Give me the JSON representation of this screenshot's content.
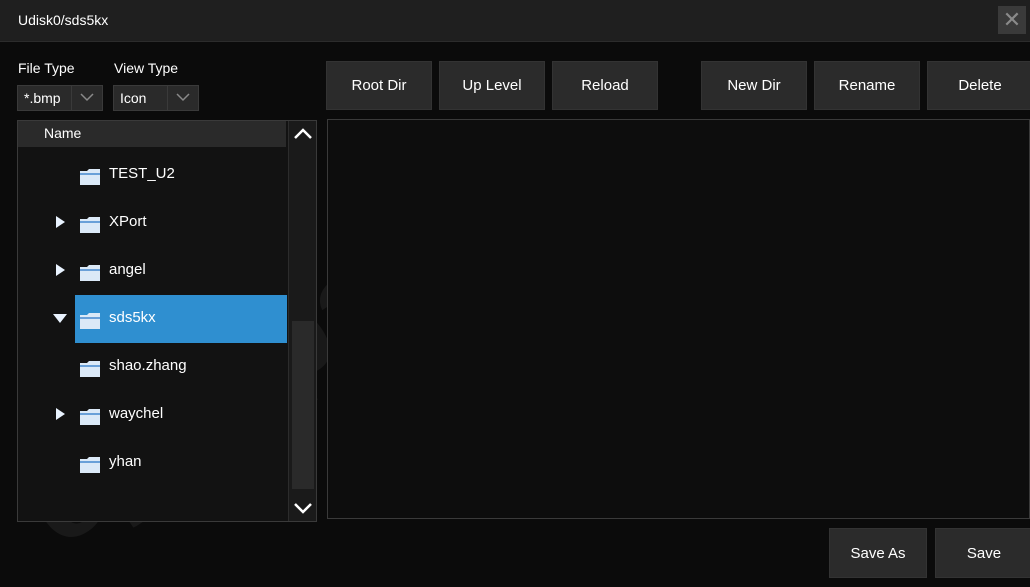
{
  "window": {
    "title": "Udisk0/sds5kx",
    "close_symbol": "✕"
  },
  "filters": {
    "file_type_label": "File Type",
    "file_type_value": "*.bmp",
    "view_type_label": "View Type",
    "view_type_value": "Icon"
  },
  "toolbar": {
    "root_dir": "Root Dir",
    "up_level": "Up Level",
    "reload": "Reload",
    "new_dir": "New Dir",
    "rename": "Rename",
    "delete": "Delete"
  },
  "tree": {
    "header": "Name",
    "items": [
      {
        "label": "TEST_U2",
        "expander": "none",
        "selected": false
      },
      {
        "label": "XPort",
        "expander": "collapsed",
        "selected": false
      },
      {
        "label": "angel",
        "expander": "collapsed",
        "selected": false
      },
      {
        "label": "sds5kx",
        "expander": "expanded",
        "selected": true
      },
      {
        "label": "shao.zhang",
        "expander": "none",
        "selected": false
      },
      {
        "label": "waychel",
        "expander": "collapsed",
        "selected": false
      },
      {
        "label": "yhan",
        "expander": "none",
        "selected": false
      }
    ]
  },
  "footer": {
    "save_as": "Save As",
    "save": "Save"
  },
  "watermark": "супераіс",
  "colors": {
    "selection": "#2f8fd0",
    "folder": "#dbe9f7"
  }
}
